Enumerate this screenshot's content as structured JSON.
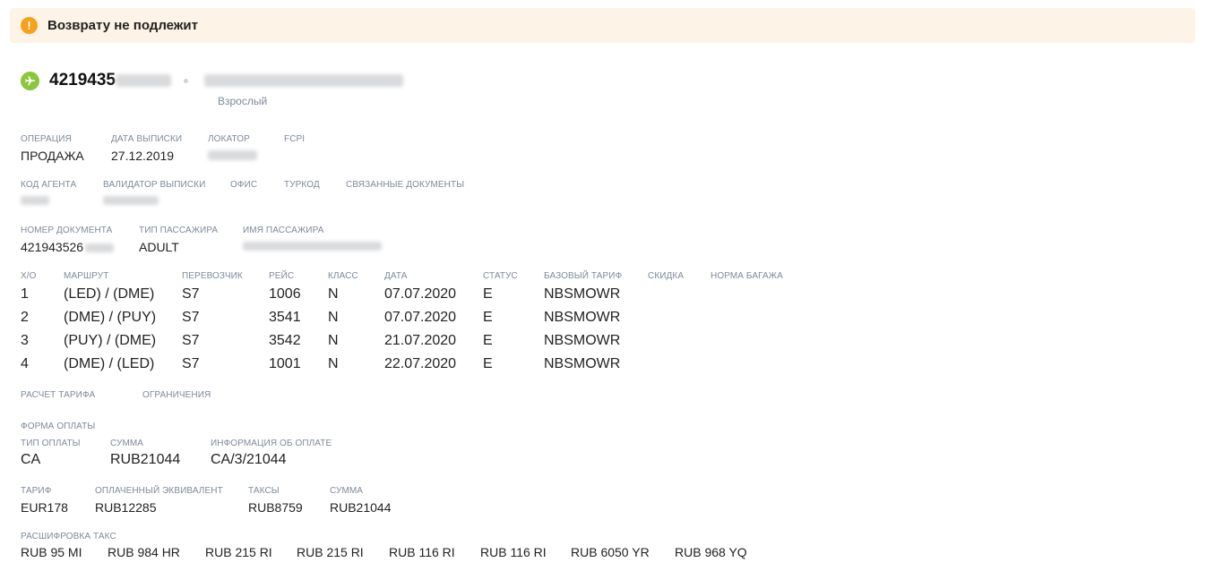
{
  "banner": {
    "text": "Возврату не подлежит",
    "icon": "exclamation-icon"
  },
  "ticket": {
    "number_visible": "4219435",
    "passenger_type": "Взрослый"
  },
  "operation": {
    "labels": {
      "operation": "ОПЕРАЦИЯ",
      "issue_date": "ДАТА ВЫПИСКИ",
      "locator": "ЛОКАТОР",
      "fcpi": "FCPI"
    },
    "operation": "ПРОДАЖА",
    "issue_date": "27.12.2019"
  },
  "agent": {
    "labels": {
      "agent_code": "КОД АГЕНТА",
      "validator": "ВАЛИДАТОР ВЫПИСКИ",
      "office": "ОФИС",
      "tourcode": "ТУРКОД",
      "related_docs": "СВЯЗАННЫЕ ДОКУМЕНТЫ"
    }
  },
  "document": {
    "labels": {
      "doc_number": "НОМЕР ДОКУМЕНТА",
      "pax_type": "ТИП ПАССАЖИРА",
      "pax_name": "ИМЯ ПАССАЖИРА"
    },
    "doc_number_visible": "421943526",
    "pax_type": "ADULT"
  },
  "segments": {
    "headers": [
      "Х/О",
      "МАРШРУТ",
      "ПЕРЕВОЗЧИК",
      "РЕЙС",
      "КЛАСС",
      "ДАТА",
      "СТАТУС",
      "БАЗОВЫЙ ТАРИФ",
      "СКИДКА",
      "НОРМА БАГАЖА"
    ],
    "rows": [
      [
        "1",
        "(LED) / (DME)",
        "S7",
        "1006",
        "N",
        "07.07.2020",
        "E",
        "NBSMOWR"
      ],
      [
        "2",
        "(DME) / (PUY)",
        "S7",
        "3541",
        "N",
        "07.07.2020",
        "E",
        "NBSMOWR"
      ],
      [
        "3",
        "(PUY) / (DME)",
        "S7",
        "3542",
        "N",
        "21.07.2020",
        "E",
        "NBSMOWR"
      ],
      [
        "4",
        "(DME) / (LED)",
        "S7",
        "1001",
        "N",
        "22.07.2020",
        "E",
        "NBSMOWR"
      ]
    ]
  },
  "fare_calc": {
    "labels": {
      "calc": "РАСЧЕТ ТАРИФА",
      "restrictions": "ОГРАНИЧЕНИЯ"
    }
  },
  "payment": {
    "section": "ФОРМА ОПЛАТЫ",
    "labels": {
      "type": "ТИП ОПЛАТЫ",
      "amount": "СУММА",
      "info": "ИНФОРМАЦИЯ ОБ ОПЛАТЕ"
    },
    "type": "CA",
    "amount": "RUB21044",
    "info": "CA/3/21044"
  },
  "totals": {
    "labels": {
      "fare": "ТАРИФ",
      "paid_equiv": "ОПЛАЧЕННЫЙ ЭКВИВАЛЕНТ",
      "taxes": "ТАКСЫ",
      "sum": "СУММА"
    },
    "fare": "EUR178",
    "paid_equiv": "RUB12285",
    "taxes": "RUB8759",
    "sum": "RUB21044"
  },
  "tax_breakdown": {
    "label": "РАСШИФРОВКА ТАКС",
    "items": [
      "RUB 95 MI",
      "RUB 984 HR",
      "RUB 215 RI",
      "RUB 215 RI",
      "RUB 116 RI",
      "RUB 116 RI",
      "RUB 6050 YR",
      "RUB 968 YQ"
    ]
  },
  "colors": {
    "banner_bg": "#fdf3e6",
    "warning": "#f5a11c",
    "airline_icon": "#8cc63f",
    "label": "#7d8a9c"
  }
}
